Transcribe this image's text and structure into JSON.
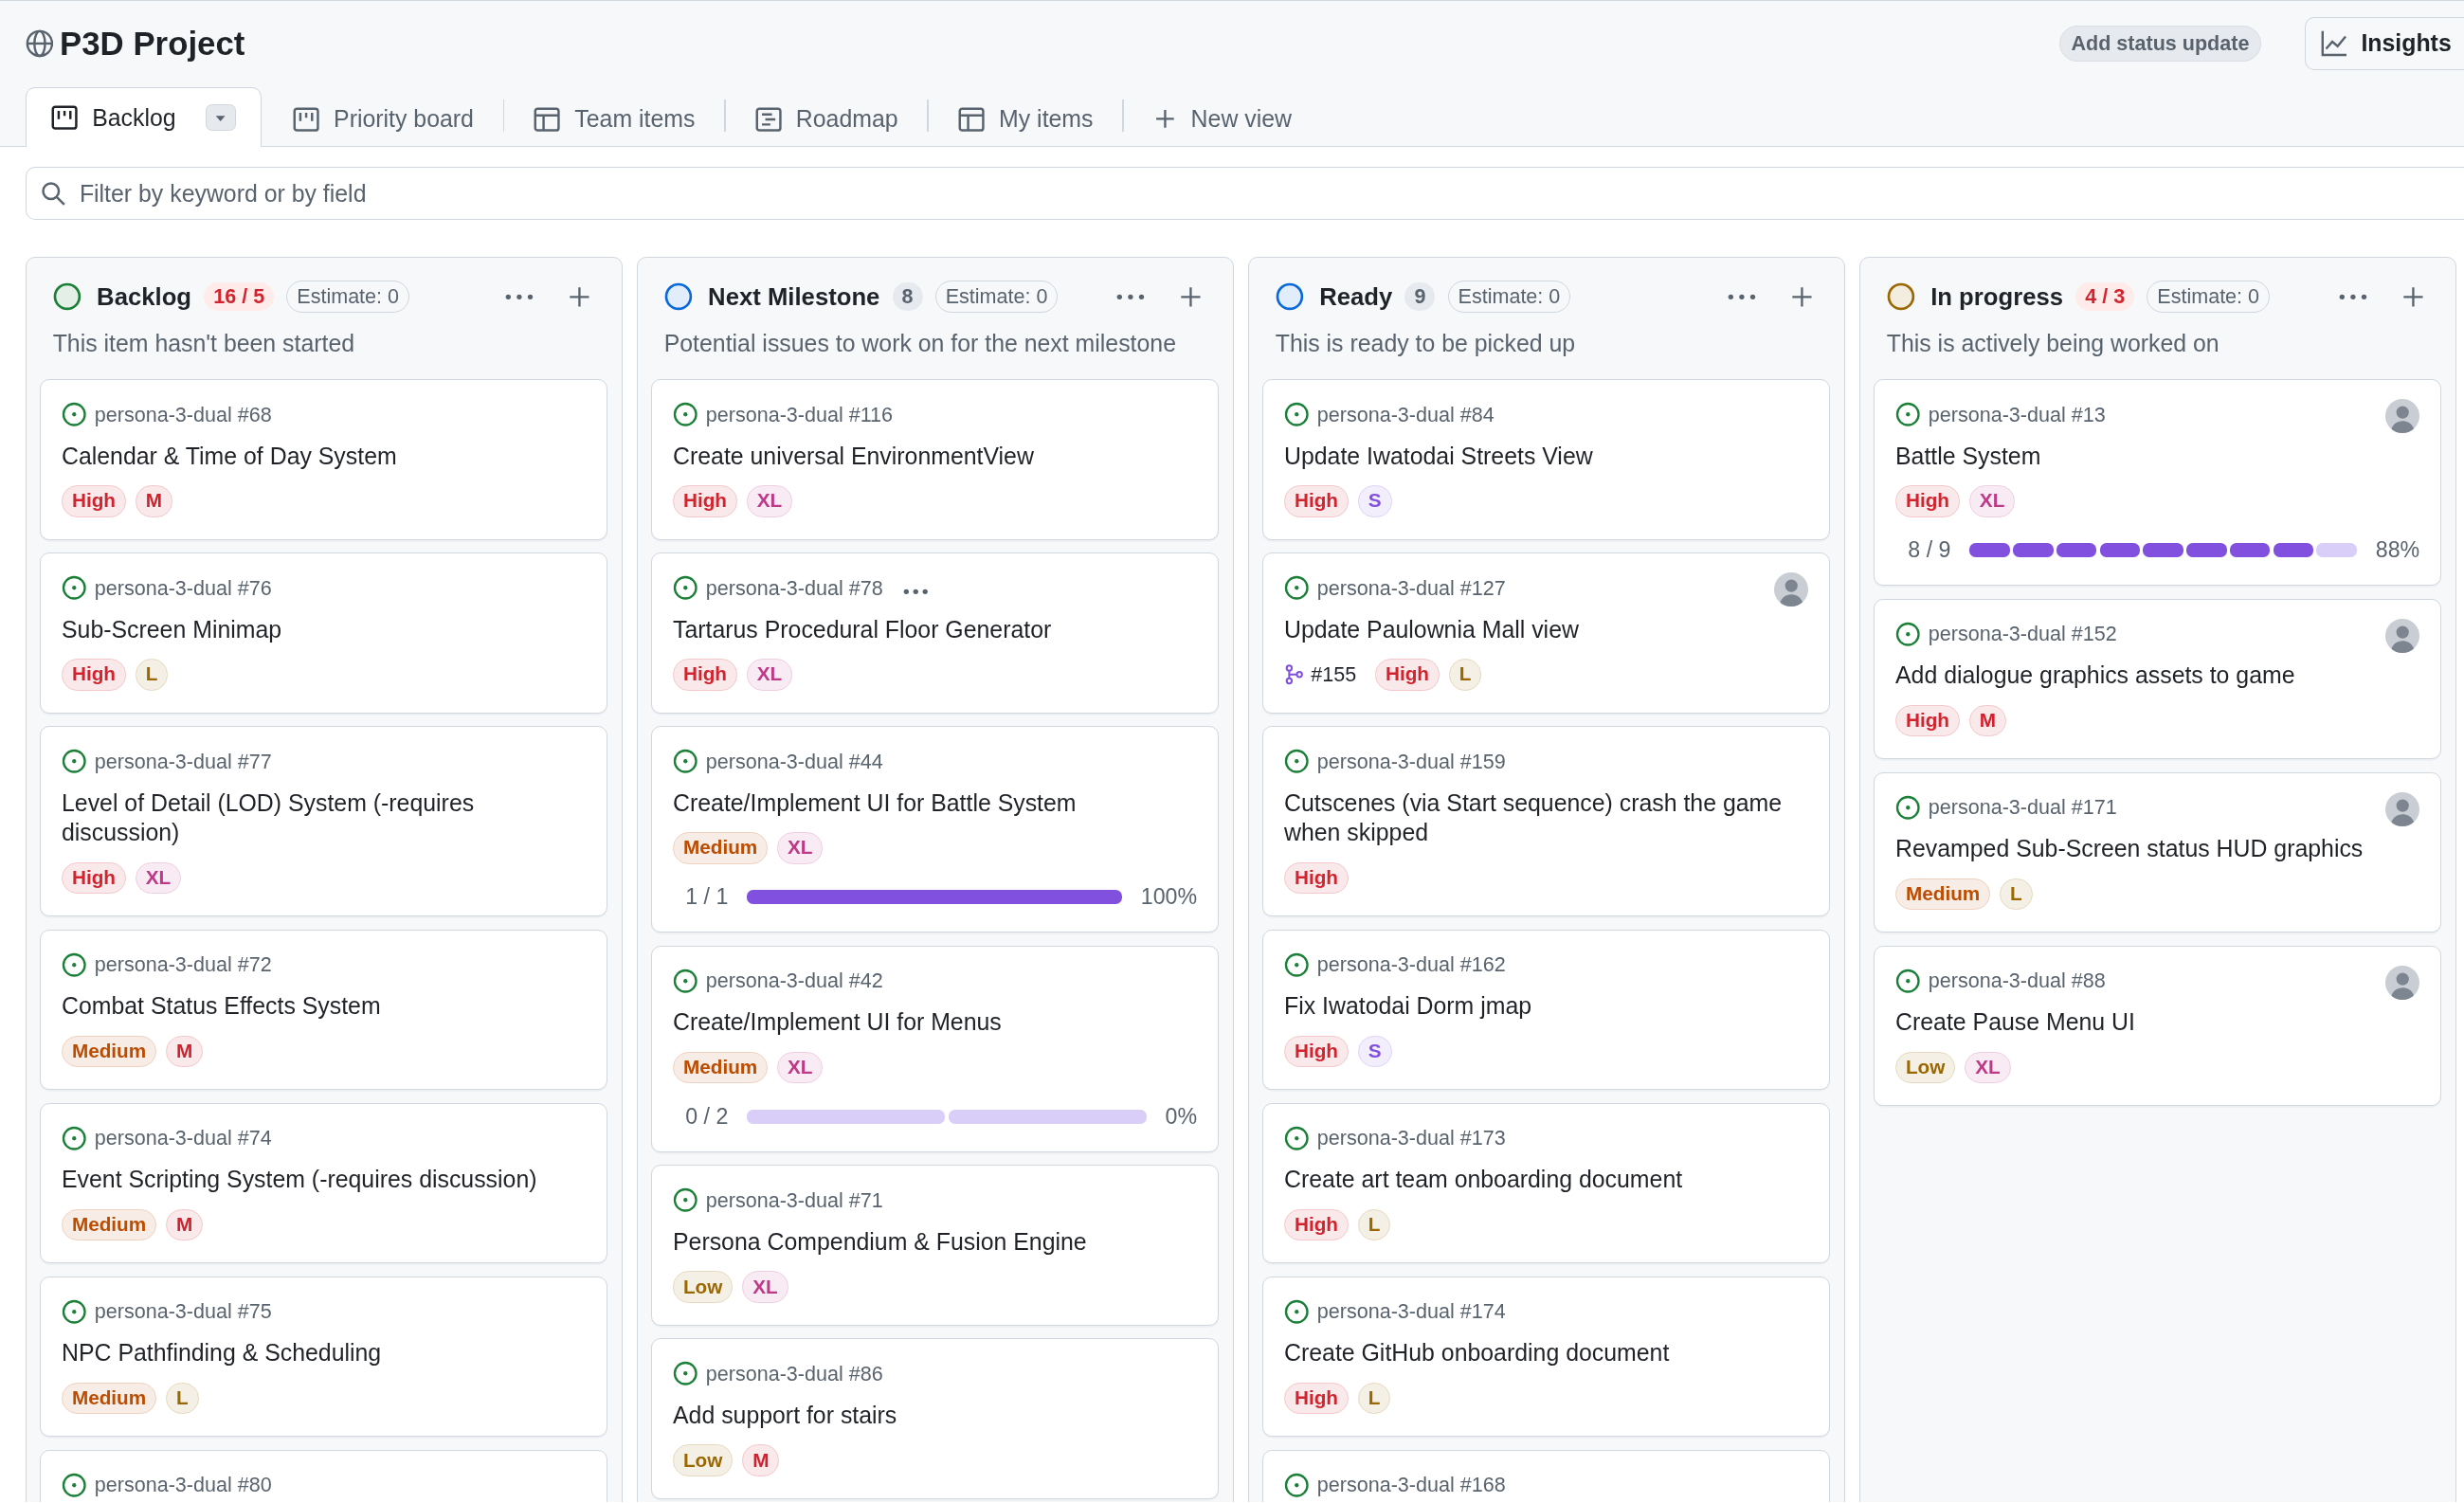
{
  "project": {
    "title": "P3D Project",
    "status_button": "Add status update",
    "insights_button": "Insights"
  },
  "tabs": [
    {
      "label": "Backlog",
      "kind": "board",
      "selected": true
    },
    {
      "label": "Priority board",
      "kind": "board",
      "selected": false
    },
    {
      "label": "Team items",
      "kind": "table",
      "selected": false
    },
    {
      "label": "Roadmap",
      "kind": "roadmap",
      "selected": false
    },
    {
      "label": "My items",
      "kind": "table",
      "selected": false
    },
    {
      "label": "New view",
      "kind": "new",
      "selected": false
    }
  ],
  "filter": {
    "placeholder": "Filter by keyword or by field"
  },
  "columns": [
    {
      "name": "Backlog",
      "color": "#1a7f37",
      "count": "16 / 5",
      "over_limit": true,
      "estimate": "Estimate: 0",
      "description": "This item hasn't been started",
      "cards": [
        {
          "repo": "persona-3-dual #68",
          "title": "Calendar & Time of Day System",
          "assigned": false,
          "labels": [
            {
              "text": "High",
              "color": "#d1242f"
            },
            {
              "text": "M",
              "color": "#cf222e"
            }
          ]
        },
        {
          "repo": "persona-3-dual #76",
          "title": "Sub-Screen Minimap",
          "assigned": false,
          "labels": [
            {
              "text": "High",
              "color": "#d1242f"
            },
            {
              "text": "L",
              "color": "#9a6700"
            }
          ]
        },
        {
          "repo": "persona-3-dual #77",
          "title": "Level of Detail (LOD) System (-requires discussion)",
          "assigned": false,
          "labels": [
            {
              "text": "High",
              "color": "#d1242f"
            },
            {
              "text": "XL",
              "color": "#bf3989"
            }
          ]
        },
        {
          "repo": "persona-3-dual #72",
          "title": "Combat Status Effects System",
          "assigned": false,
          "labels": [
            {
              "text": "Medium",
              "color": "#bc4c00"
            },
            {
              "text": "M",
              "color": "#cf222e"
            }
          ]
        },
        {
          "repo": "persona-3-dual #74",
          "title": "Event Scripting System (-requires discussion)",
          "assigned": false,
          "labels": [
            {
              "text": "Medium",
              "color": "#bc4c00"
            },
            {
              "text": "M",
              "color": "#cf222e"
            }
          ]
        },
        {
          "repo": "persona-3-dual #75",
          "title": "NPC Pathfinding & Scheduling",
          "assigned": false,
          "labels": [
            {
              "text": "Medium",
              "color": "#bc4c00"
            },
            {
              "text": "L",
              "color": "#9a6700"
            }
          ]
        },
        {
          "repo": "persona-3-dual #80",
          "assigned": false
        }
      ]
    },
    {
      "name": "Next Milestone",
      "color": "#0969da",
      "count": "8",
      "over_limit": false,
      "estimate": "Estimate: 0",
      "description": "Potential issues to work on for the next milestone",
      "cards": [
        {
          "repo": "persona-3-dual #116",
          "title": "Create universal EnvironmentView",
          "assigned": false,
          "labels": [
            {
              "text": "High",
              "color": "#d1242f"
            },
            {
              "text": "XL",
              "color": "#bf3989"
            }
          ]
        },
        {
          "repo": "persona-3-dual #78",
          "title": "Tartarus Procedural Floor Generator",
          "assigned": false,
          "hovered": true,
          "labels": [
            {
              "text": "High",
              "color": "#d1242f"
            },
            {
              "text": "XL",
              "color": "#bf3989"
            }
          ]
        },
        {
          "repo": "persona-3-dual #44",
          "title": "Create/Implement UI for Battle System",
          "assigned": false,
          "labels": [
            {
              "text": "Medium",
              "color": "#bc4c00"
            },
            {
              "text": "XL",
              "color": "#bf3989"
            }
          ],
          "progress": {
            "text": "1 / 1",
            "percent": "100%",
            "segments": [
              {
                "done": true
              }
            ]
          }
        },
        {
          "repo": "persona-3-dual #42",
          "title": "Create/Implement UI for Menus",
          "assigned": false,
          "labels": [
            {
              "text": "Medium",
              "color": "#bc4c00"
            },
            {
              "text": "XL",
              "color": "#bf3989"
            }
          ],
          "progress": {
            "text": "0 / 2",
            "percent": "0%",
            "segments": [
              {
                "done": false
              },
              {
                "done": false
              }
            ]
          }
        },
        {
          "repo": "persona-3-dual #71",
          "title": "Persona Compendium & Fusion Engine",
          "assigned": false,
          "labels": [
            {
              "text": "Low",
              "color": "#9a6700"
            },
            {
              "text": "XL",
              "color": "#bf3989"
            }
          ]
        },
        {
          "repo": "persona-3-dual #86",
          "title": "Add support for stairs",
          "assigned": false,
          "labels": [
            {
              "text": "Low",
              "color": "#9a6700"
            },
            {
              "text": "M",
              "color": "#cf222e"
            }
          ]
        }
      ]
    },
    {
      "name": "Ready",
      "color": "#0969da",
      "count": "9",
      "over_limit": false,
      "estimate": "Estimate: 0",
      "description": "This is ready to be picked up",
      "cards": [
        {
          "repo": "persona-3-dual #84",
          "title": "Update Iwatodai Streets View",
          "assigned": false,
          "labels": [
            {
              "text": "High",
              "color": "#d1242f"
            },
            {
              "text": "S",
              "color": "#8250df"
            }
          ]
        },
        {
          "repo": "persona-3-dual #127",
          "title": "Update Paulownia Mall view",
          "assigned": true,
          "linked_pr": "#155",
          "labels": [
            {
              "text": "High",
              "color": "#d1242f"
            },
            {
              "text": "L",
              "color": "#9a6700"
            }
          ]
        },
        {
          "repo": "persona-3-dual #159",
          "title": "Cutscenes (via Start sequence) crash the game when skipped",
          "assigned": false,
          "labels": [
            {
              "text": "High",
              "color": "#d1242f"
            }
          ]
        },
        {
          "repo": "persona-3-dual #162",
          "title": "Fix Iwatodai Dorm jmap",
          "assigned": false,
          "labels": [
            {
              "text": "High",
              "color": "#d1242f"
            },
            {
              "text": "S",
              "color": "#8250df"
            }
          ]
        },
        {
          "repo": "persona-3-dual #173",
          "title": "Create art team onboarding document",
          "assigned": false,
          "labels": [
            {
              "text": "High",
              "color": "#d1242f"
            },
            {
              "text": "L",
              "color": "#9a6700"
            }
          ]
        },
        {
          "repo": "persona-3-dual #174",
          "title": "Create GitHub onboarding document",
          "assigned": false,
          "labels": [
            {
              "text": "High",
              "color": "#d1242f"
            },
            {
              "text": "L",
              "color": "#9a6700"
            }
          ]
        },
        {
          "repo": "persona-3-dual #168",
          "assigned": false
        }
      ]
    },
    {
      "name": "In progress",
      "color": "#9a6700",
      "count": "4 / 3",
      "over_limit": true,
      "estimate": "Estimate: 0",
      "description": "This is actively being worked on",
      "cards": [
        {
          "repo": "persona-3-dual #13",
          "title": "Battle System",
          "assigned": true,
          "labels": [
            {
              "text": "High",
              "color": "#d1242f"
            },
            {
              "text": "XL",
              "color": "#bf3989"
            }
          ],
          "progress": {
            "text": "8 / 9",
            "percent": "88%",
            "segments": [
              {
                "done": true
              },
              {
                "done": true
              },
              {
                "done": true
              },
              {
                "done": true
              },
              {
                "done": true
              },
              {
                "done": true
              },
              {
                "done": true
              },
              {
                "done": true
              },
              {
                "done": false
              }
            ]
          }
        },
        {
          "repo": "persona-3-dual #152",
          "title": "Add dialogue graphics assets to game",
          "assigned": true,
          "labels": [
            {
              "text": "High",
              "color": "#d1242f"
            },
            {
              "text": "M",
              "color": "#cf222e"
            }
          ]
        },
        {
          "repo": "persona-3-dual #171",
          "title": "Revamped Sub-Screen status HUD graphics",
          "assigned": true,
          "labels": [
            {
              "text": "Medium",
              "color": "#bc4c00"
            },
            {
              "text": "L",
              "color": "#9a6700"
            }
          ]
        },
        {
          "repo": "persona-3-dual #88",
          "title": "Create Pause Menu UI",
          "assigned": true,
          "labels": [
            {
              "text": "Low",
              "color": "#9a6700"
            },
            {
              "text": "XL",
              "color": "#bf3989"
            }
          ]
        }
      ]
    }
  ]
}
